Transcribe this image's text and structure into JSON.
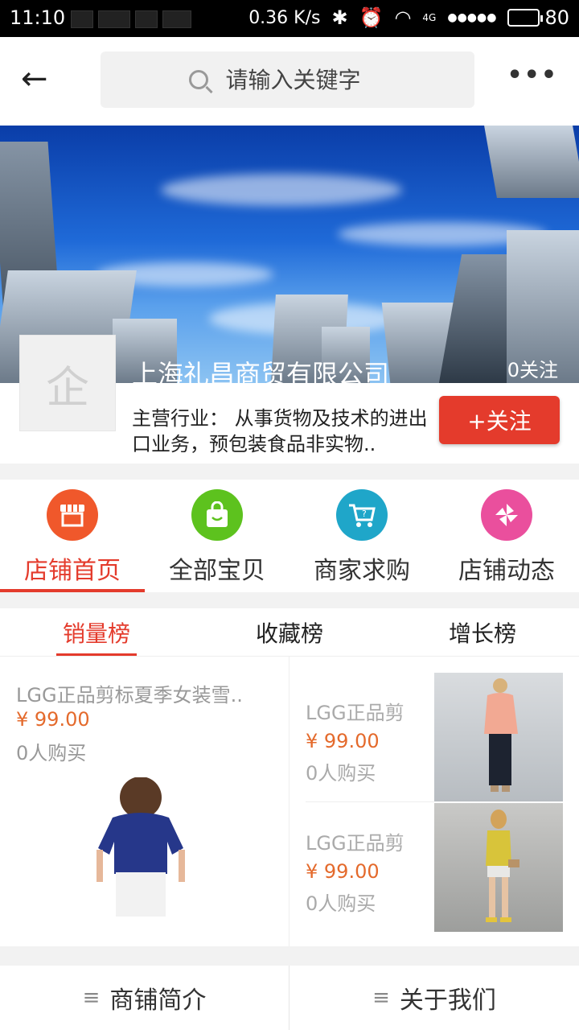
{
  "status": {
    "time": "11:10",
    "speed": "0.36 K/s",
    "network": "4G",
    "battery": "80",
    "battery_level": 0.8
  },
  "header": {
    "search_placeholder": "请输入关键字"
  },
  "shop": {
    "name": "上海礼昌商贸有限公司",
    "followers": "0关注",
    "logo_char": "企",
    "industry": "主营行业： 从事货物及技术的进出口业务，预包装食品非实物..",
    "follow_button": "+关注"
  },
  "nav": [
    {
      "label": "店铺首页",
      "icon": "store-icon",
      "color": "#f0582b"
    },
    {
      "label": "全部宝贝",
      "icon": "shopping-bag-icon",
      "color": "#5dc21e"
    },
    {
      "label": "商家求购",
      "icon": "cart-question-icon",
      "color": "#1fa6c9"
    },
    {
      "label": "店铺动态",
      "icon": "pinwheel-icon",
      "color": "#ea4f9d"
    }
  ],
  "rank_tabs": [
    "销量榜",
    "收藏榜",
    "增长榜"
  ],
  "products": {
    "featured": {
      "title": "LGG正品剪标夏季女装雪..",
      "price": "¥ 99.00",
      "sold": "0人购买"
    },
    "list": [
      {
        "title": "LGG正品剪",
        "price": "¥ 99.00",
        "sold": "0人购买"
      },
      {
        "title": "LGG正品剪",
        "price": "¥ 99.00",
        "sold": "0人购买"
      }
    ]
  },
  "bottom": {
    "intro": "商铺简介",
    "about": "关于我们"
  },
  "colors": {
    "accent": "#e43b2c",
    "price": "#e46a2c"
  }
}
